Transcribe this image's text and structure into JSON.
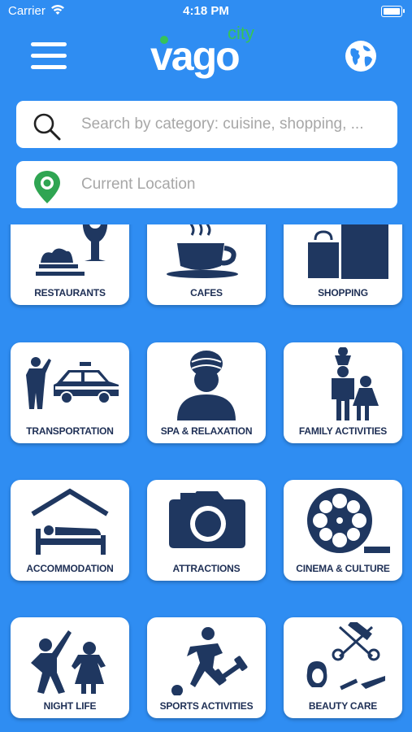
{
  "status": {
    "carrier": "Carrier",
    "time": "4:18 PM"
  },
  "header": {
    "logo_main": "vago",
    "logo_sub": "city"
  },
  "search": {
    "placeholder": "Search by category: cuisine, shopping, ..."
  },
  "location": {
    "placeholder": "Current Location"
  },
  "colors": {
    "background": "#2f8df2",
    "icon": "#1f3760",
    "accent": "#36c25a"
  },
  "categories": [
    {
      "label": "RESTAURANTS",
      "icon": "restaurant-icon"
    },
    {
      "label": "CAFES",
      "icon": "coffee-cup-icon"
    },
    {
      "label": "SHOPPING",
      "icon": "shopping-bags-icon"
    },
    {
      "label": "TRANSPORTATION",
      "icon": "taxi-icon"
    },
    {
      "label": "SPA & RELAXATION",
      "icon": "spa-person-icon"
    },
    {
      "label": "FAMILY ACTIVITIES",
      "icon": "family-icon"
    },
    {
      "label": "ACCOMMODATION",
      "icon": "bed-house-icon"
    },
    {
      "label": "ATTRACTIONS",
      "icon": "camera-icon"
    },
    {
      "label": "CINEMA & CULTURE",
      "icon": "film-reel-icon"
    },
    {
      "label": "NIGHT LIFE",
      "icon": "dancing-icon"
    },
    {
      "label": "SPORTS ACTIVITIES",
      "icon": "sports-icon"
    },
    {
      "label": "BEAUTY CARE",
      "icon": "beauty-icon"
    }
  ]
}
